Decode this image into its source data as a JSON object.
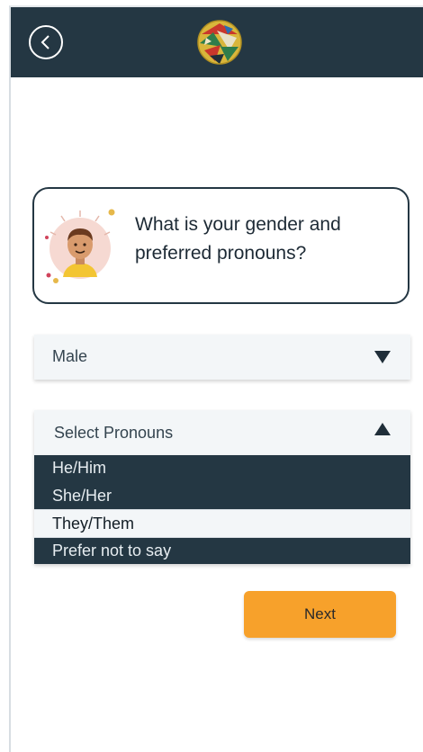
{
  "header": {
    "back_icon": "chevron-left-icon",
    "logo_icon": "globe-logo-icon"
  },
  "question": {
    "text": "What is your gender and preferred pronouns?",
    "avatar_icon": "person-avatar-icon"
  },
  "gender_select": {
    "selected_value": "Male",
    "arrow_icon": "triangle-down-icon"
  },
  "pronouns_select": {
    "placeholder": "Select Pronouns",
    "arrow_icon": "triangle-up-icon",
    "options": [
      {
        "label": "He/Him",
        "selected": false
      },
      {
        "label": "She/Her",
        "selected": false
      },
      {
        "label": "They/Them",
        "selected": true
      },
      {
        "label": "Prefer not to say",
        "selected": false
      }
    ]
  },
  "actions": {
    "next_label": "Next"
  },
  "colors": {
    "header_bg": "#243743",
    "accent": "#f7a12b",
    "dropdown_bg": "#243743",
    "select_bg": "#f3f6f8"
  }
}
